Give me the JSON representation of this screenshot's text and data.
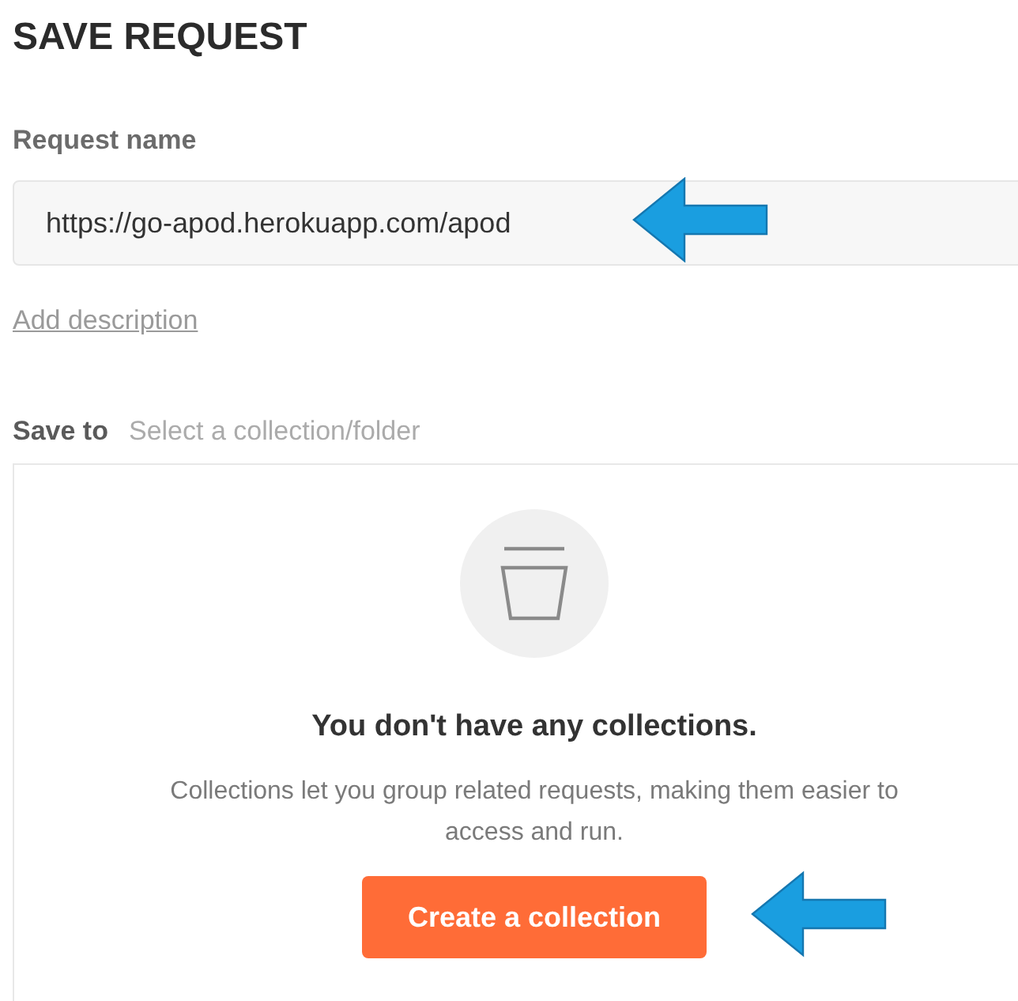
{
  "title": "SAVE REQUEST",
  "request_name": {
    "label": "Request name",
    "value": "https://go-apod.herokuapp.com/apod",
    "pointed_by_arrow": true
  },
  "add_description": "Add description",
  "save_to": {
    "label": "Save to",
    "placeholder": "Select a collection/folder"
  },
  "empty_state": {
    "heading": "You don't have any collections.",
    "text": "Collections let you group related requests, making them easier to access and run.",
    "button": {
      "label": "Create a collection",
      "pointed_by_arrow": true
    }
  }
}
